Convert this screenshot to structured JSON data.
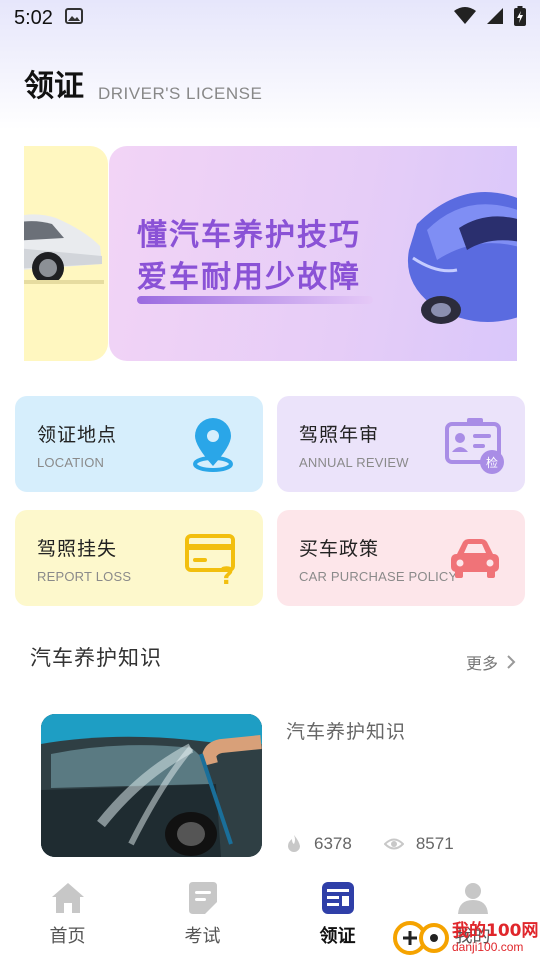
{
  "status_bar": {
    "time": "5:02"
  },
  "header": {
    "title": "领证",
    "subtitle": "DRIVER'S LICENSE"
  },
  "banner": {
    "line1": "懂汽车养护技巧",
    "line2": "爱车耐用少故障"
  },
  "cards": [
    {
      "title": "领证地点",
      "subtitle": "LOCATION",
      "icon": "location-pin-icon",
      "color": "#d6eefc"
    },
    {
      "title": "驾照年审",
      "subtitle": "ANNUAL REVIEW",
      "icon": "id-card-inspect-icon",
      "color": "#ebe3fa"
    },
    {
      "title": "驾照挂失",
      "subtitle": "REPORT LOSS",
      "icon": "card-question-icon",
      "color": "#fdf8cc"
    },
    {
      "title": "买车政策",
      "subtitle": "CAR PURCHASE POLICY",
      "icon": "car-icon",
      "color": "#fde6ea"
    }
  ],
  "section": {
    "title": "汽车养护知识",
    "more": "更多"
  },
  "article": {
    "title": "汽车养护知识",
    "hot_count": "6378",
    "view_count": "8571"
  },
  "tabs": [
    {
      "label": "首页",
      "icon": "home-icon",
      "active": false
    },
    {
      "label": "考试",
      "icon": "exam-icon",
      "active": false
    },
    {
      "label": "领证",
      "icon": "license-icon",
      "active": true
    },
    {
      "label": "我的",
      "icon": "profile-icon",
      "active": false
    }
  ],
  "watermark": {
    "brand": "我的100网",
    "domain": "danji100.com"
  }
}
